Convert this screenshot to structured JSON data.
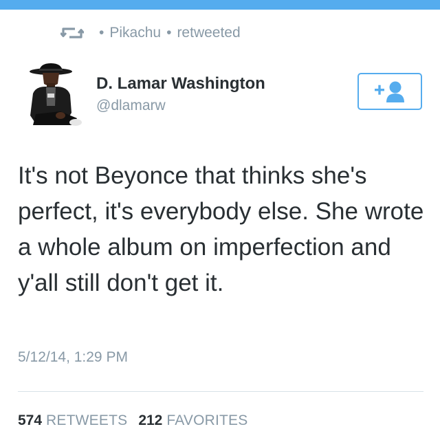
{
  "colors": {
    "accent": "#55acee",
    "text": "#292f33",
    "muted": "#8899a6",
    "divider": "#d8e2e8"
  },
  "retweet_context": {
    "icon": "retweet-icon",
    "separator": "•",
    "user": "Pikachu",
    "action": "retweeted"
  },
  "author": {
    "avatar_icon": "avatar",
    "name": "D. Lamar Washington",
    "handle": "@dlamarw"
  },
  "follow_button": {
    "icon": "follow-user-icon"
  },
  "tweet": {
    "text": "It's not Beyonce that thinks she's perfect, it's everybody else. She wrote a whole album on imperfection and y'all still don't get it.",
    "timestamp": "5/12/14, 1:29 PM"
  },
  "stats": {
    "retweets_count": "574",
    "retweets_label": "RETWEETS",
    "favorites_count": "212",
    "favorites_label": "FAVORITES"
  }
}
